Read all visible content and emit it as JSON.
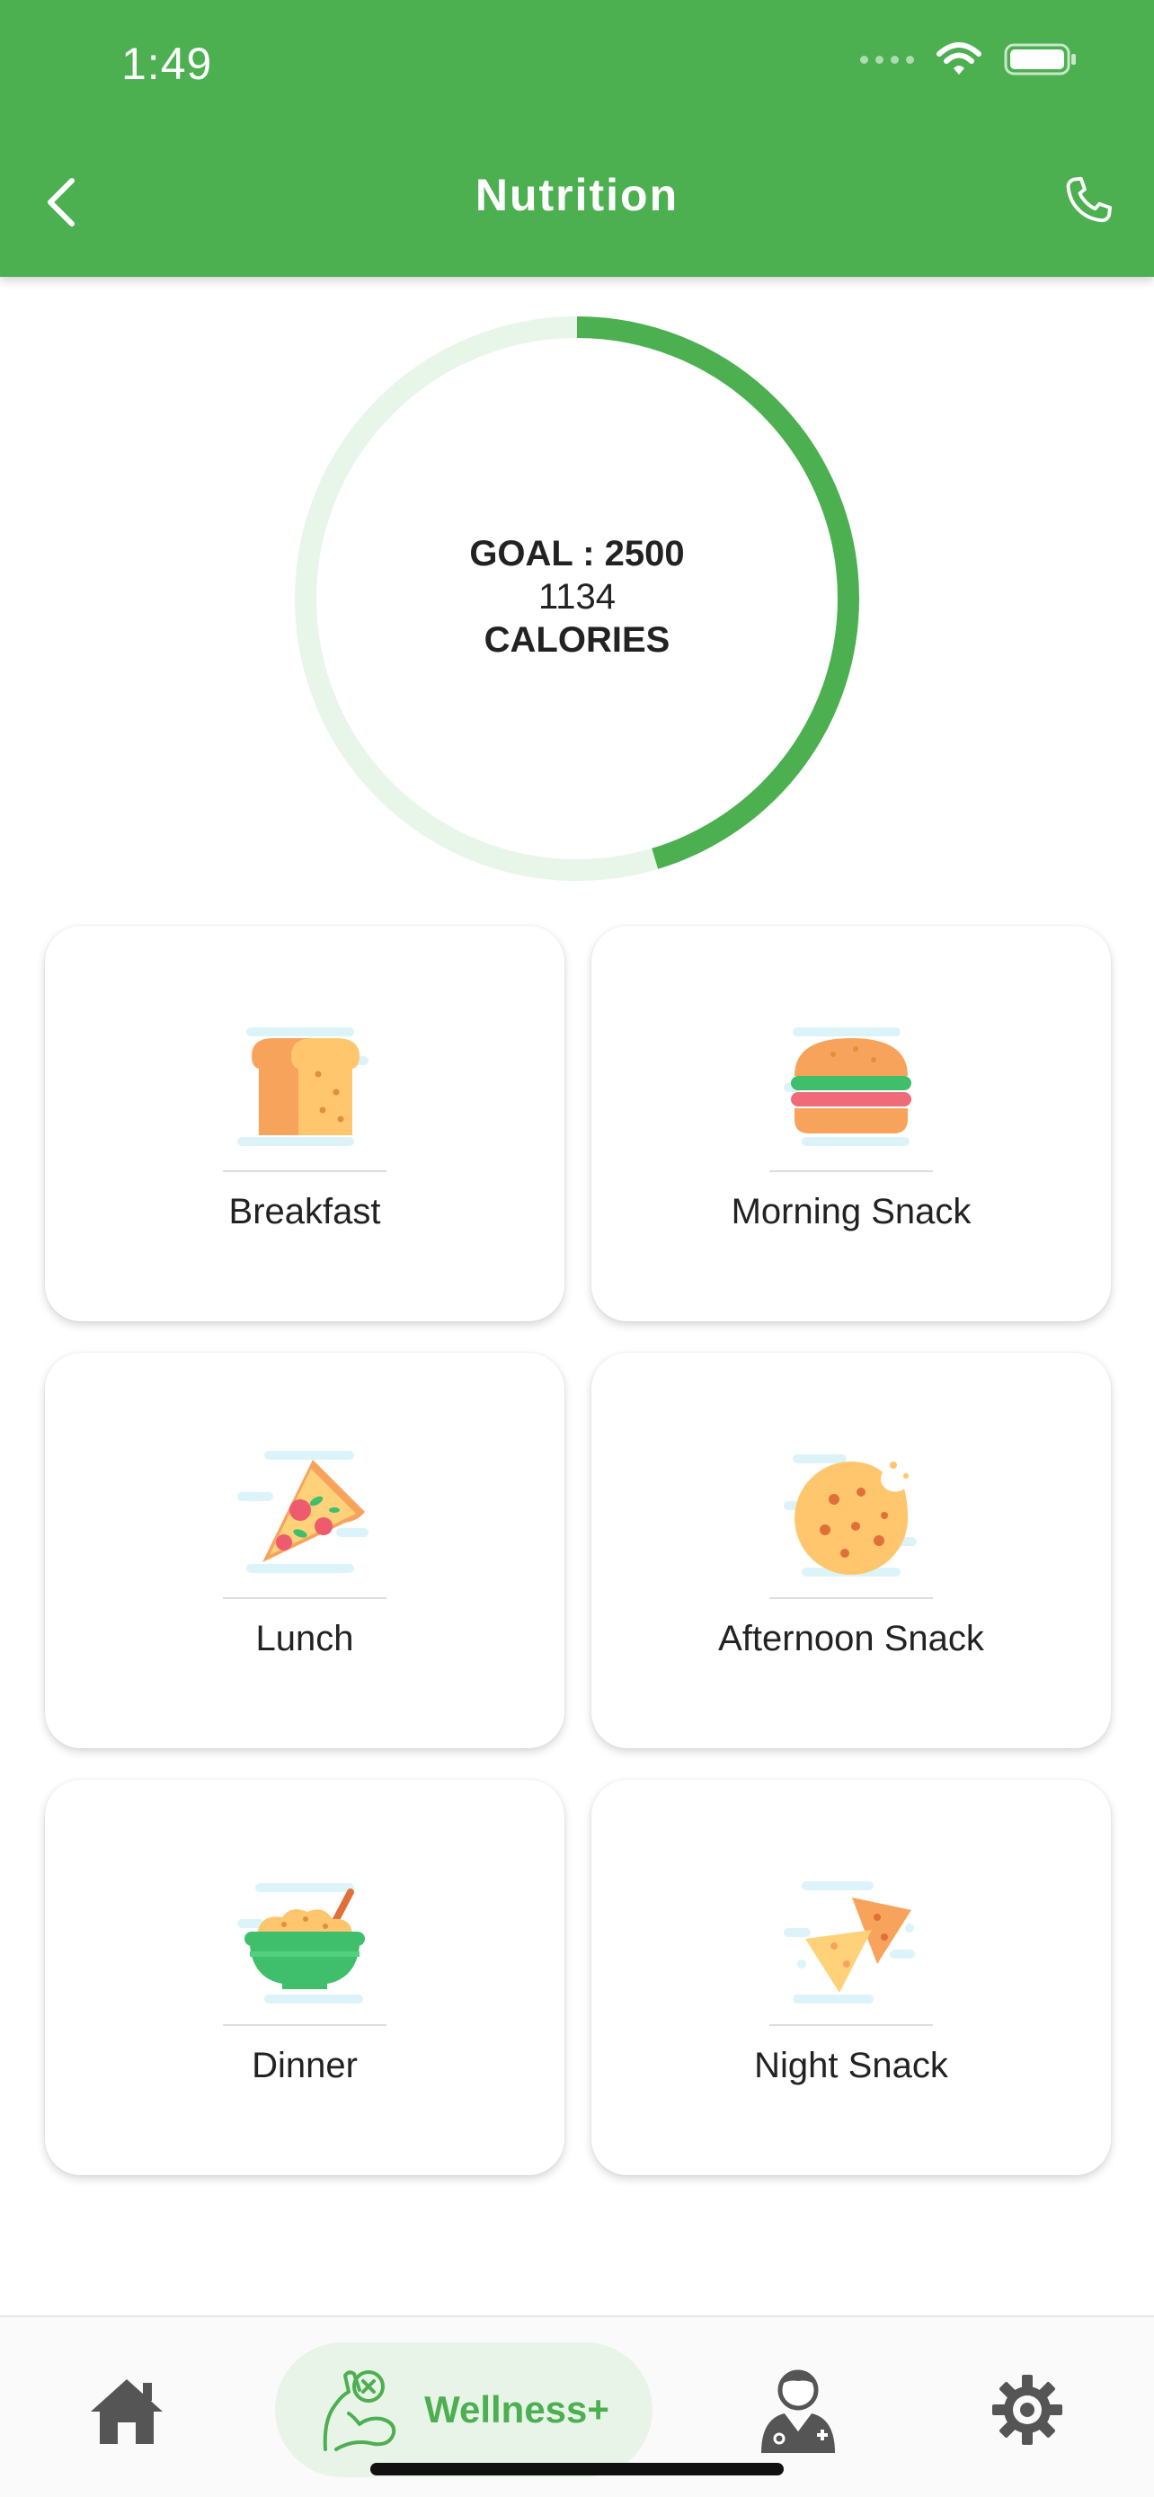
{
  "status_bar": {
    "time": "1:49"
  },
  "header": {
    "title": "Nutrition"
  },
  "calories": {
    "goal_label": "GOAL : 2500",
    "consumed": "1134",
    "unit": "CALORIES",
    "progress_fraction": 0.4536
  },
  "meals": [
    {
      "label": "Breakfast",
      "icon": "bread-icon"
    },
    {
      "label": "Morning Snack",
      "icon": "burger-icon"
    },
    {
      "label": "Lunch",
      "icon": "pizza-icon"
    },
    {
      "label": "Afternoon Snack",
      "icon": "cookie-icon"
    },
    {
      "label": "Dinner",
      "icon": "bowl-icon"
    },
    {
      "label": "Night Snack",
      "icon": "nachos-icon"
    }
  ],
  "bottom_nav": {
    "home": "home-icon",
    "wellness_label": "Wellness+",
    "doctor": "doctor-icon",
    "settings": "gear-icon"
  },
  "colors": {
    "primary": "#4CAF50",
    "ring_track": "#E8F5E9",
    "wellness_bg": "#E8F4E8",
    "nav_icon": "#555555"
  }
}
